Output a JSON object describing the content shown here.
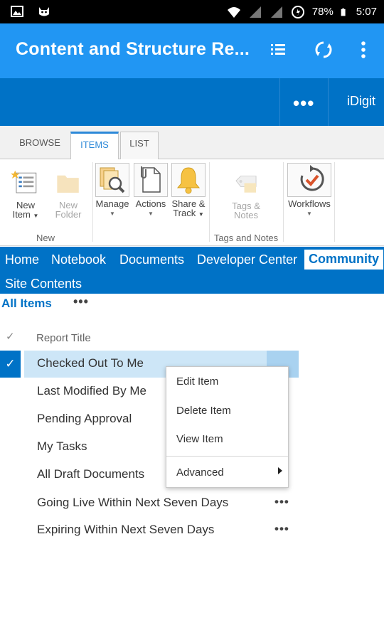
{
  "status_bar": {
    "battery_percent": "78%",
    "time": "5:07",
    "icons": [
      "image-icon",
      "cat-icon",
      "wifi-icon",
      "signal-icon",
      "signal-icon-2",
      "data-saver-icon",
      "battery-icon"
    ]
  },
  "app_bar": {
    "title": "Content and Structure Re...",
    "actions": [
      "list-view-icon",
      "refresh-icon",
      "overflow-menu-icon"
    ],
    "color": "#2196f3"
  },
  "suite_bar": {
    "more_label": "•••",
    "user_label": "iDigit",
    "color": "#0072c6"
  },
  "ribbon": {
    "tabs": [
      {
        "label": "BROWSE",
        "active": false
      },
      {
        "label": "ITEMS",
        "active": true
      },
      {
        "label": "LIST",
        "active": false
      }
    ],
    "groups": [
      {
        "label": "New",
        "buttons": [
          {
            "line1": "New",
            "line2": "Item",
            "icon": "new-item-icon",
            "enabled": true
          },
          {
            "line1": "New",
            "line2": "Folder",
            "icon": "new-folder-icon",
            "enabled": false
          }
        ]
      },
      {
        "label": "",
        "buttons": [
          {
            "line1": "Manage",
            "icon": "manage-icon",
            "enabled": true
          },
          {
            "line1": "Actions",
            "icon": "actions-icon",
            "enabled": true
          },
          {
            "line1": "Share &",
            "line2": "Track",
            "icon": "bell-icon",
            "enabled": true
          }
        ]
      },
      {
        "label": "Tags and Notes",
        "buttons": [
          {
            "line1": "Tags &",
            "line2": "Notes",
            "icon": "tag-icon",
            "enabled": false
          }
        ]
      },
      {
        "label": "",
        "buttons": [
          {
            "line1": "Workflows",
            "icon": "workflow-icon",
            "enabled": true
          }
        ]
      }
    ]
  },
  "nav": {
    "items": [
      "Home",
      "Notebook",
      "Documents",
      "Developer Center",
      "Community",
      "Site Contents"
    ],
    "selected": "Community"
  },
  "view": {
    "label": "All Items",
    "more": "•••"
  },
  "list": {
    "column_header": "Report Title",
    "check_header": "✓",
    "rows": [
      {
        "title": "Checked Out To Me",
        "selected": true
      },
      {
        "title": "Last Modified By Me",
        "selected": false
      },
      {
        "title": "Pending Approval",
        "selected": false
      },
      {
        "title": "My Tasks",
        "selected": false
      },
      {
        "title": "All Draft Documents",
        "selected": false
      },
      {
        "title": "Going Live Within Next Seven Days",
        "selected": false
      },
      {
        "title": "Expiring Within Next Seven Days",
        "selected": false
      }
    ],
    "row_more": "•••",
    "selected_check": "✓"
  },
  "context_menu": {
    "items": [
      "Edit Item",
      "Delete Item",
      "View Item"
    ],
    "submenu_item": "Advanced"
  }
}
